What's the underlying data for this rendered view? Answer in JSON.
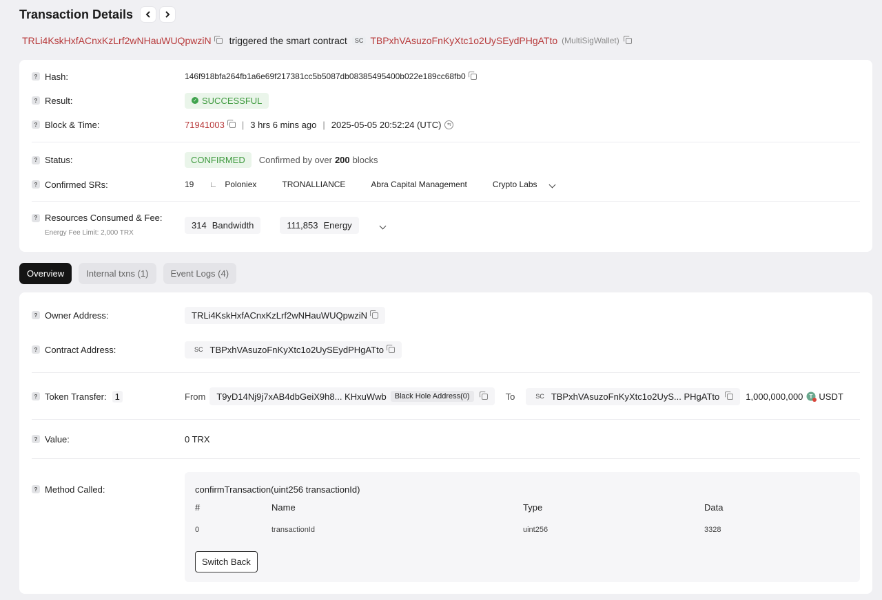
{
  "header": {
    "title": "Transaction Details",
    "prev_icon": "chevron-left-icon",
    "next_icon": "chevron-right-icon"
  },
  "subheader": {
    "owner": "TRLi4KskHxfACnxKzLrf2wNHauWUQpwziN",
    "action": "triggered the smart contract",
    "sc_tag": "SC",
    "contract": "TBPxhVAsuzoFnKyXtc1o2UySEydPHgATto",
    "contract_name": "(MultiSigWallet)"
  },
  "summary": {
    "hash_label": "Hash:",
    "hash": "146f918bfa264fb1a6e69f217381cc5b5087db08385495400b022e189cc68fb0",
    "result_label": "Result:",
    "result": "SUCCESSFUL",
    "block_time_label": "Block & Time:",
    "block": "71941003",
    "age": "3 hrs 6 mins ago",
    "timestamp": "2025-05-05 20:52:24 (UTC)",
    "status_label": "Status:",
    "status": "CONFIRMED",
    "confirmed_prefix": "Confirmed by over",
    "confirmed_count": "200",
    "confirmed_suffix": "blocks",
    "srs_label": "Confirmed SRs:",
    "srs_count": "19",
    "srs": [
      "Poloniex",
      "TRONALLIANCE",
      "Abra Capital Management",
      "Crypto Labs"
    ],
    "resources_label": "Resources Consumed & Fee:",
    "fee_limit": "Energy Fee Limit: 2,000 TRX",
    "bandwidth_value": "314",
    "bandwidth_label": "Bandwidth",
    "energy_value": "111,853",
    "energy_label": "Energy"
  },
  "tabs": [
    {
      "label": "Overview",
      "active": true
    },
    {
      "label": "Internal txns (1)",
      "active": false
    },
    {
      "label": "Event Logs (4)",
      "active": false
    }
  ],
  "overview": {
    "owner_label": "Owner Address:",
    "owner": "TRLi4KskHxfACnxKzLrf2wNHauWUQpwziN",
    "contract_label": "Contract Address:",
    "contract_tag": "SC",
    "contract": "TBPxhVAsuzoFnKyXtc1o2UySEydPHgATto",
    "token_transfer_label": "Token Transfer:",
    "token_transfer_count": "1",
    "from_label": "From",
    "from_address": "T9yD14Nj9j7xAB4dbGeiX9h8... KHxuWwb",
    "from_tag": "Black Hole Address(0)",
    "to_label": "To",
    "to_tag": "SC",
    "to_address": "TBPxhVAsuzoFnKyXtc1o2UyS... PHgATto",
    "amount": "1,000,000,000",
    "token": "USDT",
    "value_label": "Value:",
    "value": "0 TRX",
    "method_label": "Method Called:",
    "method_signature": "confirmTransaction(uint256 transactionId)",
    "columns": [
      "#",
      "Name",
      "Type",
      "Data"
    ],
    "params": [
      {
        "index": "0",
        "name": "transactionId",
        "type": "uint256",
        "data": "3328"
      }
    ],
    "switch_label": "Switch Back"
  },
  "colors": {
    "accent_red": "#b7393a",
    "success_green": "#3e9a3e",
    "tab_active": "#141414"
  }
}
